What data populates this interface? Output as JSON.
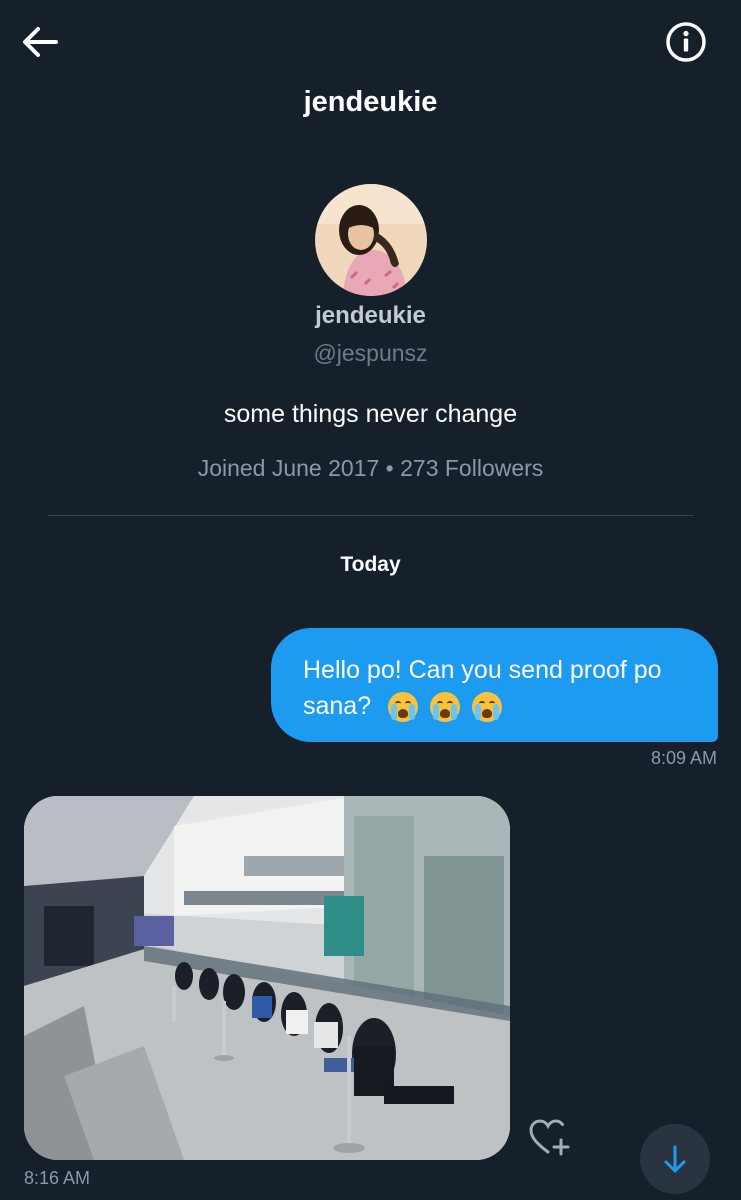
{
  "header": {
    "title": "jendeukie",
    "back_icon": "arrow-left-icon",
    "info_icon": "info-circle-icon"
  },
  "profile": {
    "display_name": "jendeukie",
    "handle": "@jespunsz",
    "bio": "some things never change",
    "meta": "Joined June 2017 • 273 Followers"
  },
  "conversation": {
    "date_separator": "Today",
    "messages": [
      {
        "direction": "sent",
        "text": "Hello po! Can you send proof po sana?",
        "emoji": [
          "loudly-crying-face",
          "loudly-crying-face",
          "loudly-crying-face"
        ],
        "time": "8:09 AM"
      },
      {
        "direction": "received",
        "type": "photo",
        "description": "mall-atrium-queue-photo",
        "time": "8:16 AM"
      }
    ]
  },
  "actions": {
    "like_icon": "heart-plus-icon",
    "scroll_icon": "arrow-down-icon"
  },
  "colors": {
    "background": "#15202b",
    "accent": "#1d9bf0",
    "muted_text": "#8b98a5"
  }
}
